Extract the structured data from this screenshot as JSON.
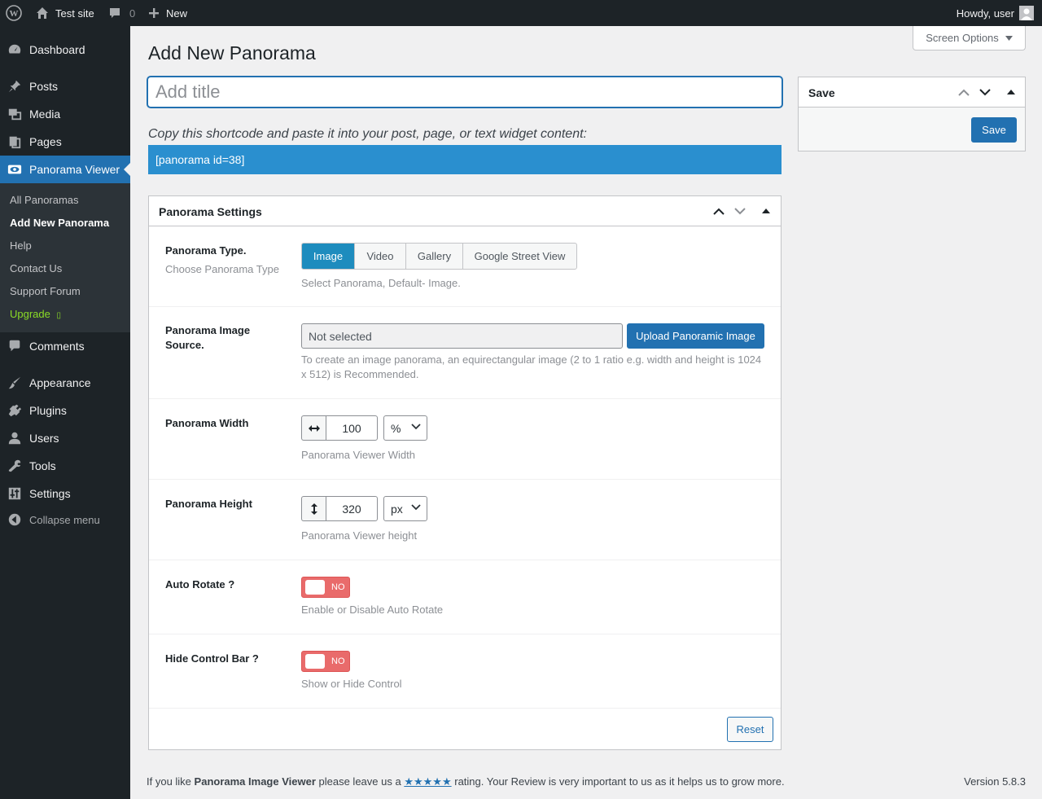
{
  "admin_bar": {
    "site_name": "Test site",
    "comments_count": "0",
    "new_label": "New",
    "howdy": "Howdy, user"
  },
  "sidebar": {
    "items": [
      {
        "label": "Dashboard",
        "icon": "dashboard-icon"
      },
      {
        "label": "Posts",
        "icon": "pin-icon"
      },
      {
        "label": "Media",
        "icon": "media-icon"
      },
      {
        "label": "Pages",
        "icon": "pages-icon"
      },
      {
        "label": "Panorama Viewer",
        "icon": "eye-icon"
      },
      {
        "label": "Comments",
        "icon": "comment-icon"
      },
      {
        "label": "Appearance",
        "icon": "brush-icon"
      },
      {
        "label": "Plugins",
        "icon": "plug-icon"
      },
      {
        "label": "Users",
        "icon": "user-icon"
      },
      {
        "label": "Tools",
        "icon": "wrench-icon"
      },
      {
        "label": "Settings",
        "icon": "sliders-icon"
      },
      {
        "label": "Collapse menu",
        "icon": "collapse-icon"
      }
    ],
    "submenu": [
      "All Panoramas",
      "Add New Panorama",
      "Help",
      "Contact Us",
      "Support Forum",
      "Upgrade"
    ],
    "upgrade_glyph": "▯"
  },
  "screen_options": "Screen Options",
  "page_title": "Add New Panorama",
  "title_placeholder": "Add title",
  "shortcode": {
    "label": "Copy this shortcode and paste it into your post, page, or text widget content:",
    "value": "[panorama id=38]"
  },
  "settings": {
    "title": "Panorama Settings",
    "type": {
      "label": "Panorama Type.",
      "sublabel": "Choose Panorama Type",
      "options": [
        "Image",
        "Video",
        "Gallery",
        "Google Street View"
      ],
      "selected": "Image",
      "desc": "Select Panorama, Default- Image."
    },
    "source": {
      "label": "Panorama Image Source.",
      "value": "Not selected",
      "button": "Upload Panoramic Image",
      "desc": "To create an image panorama, an equirectangular image (2 to 1 ratio e.g. width and height is 1024 x 512) is Recommended."
    },
    "width": {
      "label": "Panorama Width",
      "value": "100",
      "unit": "%",
      "desc": "Panorama Viewer Width"
    },
    "height": {
      "label": "Panorama Height",
      "value": "320",
      "unit": "px",
      "desc": "Panorama Viewer height"
    },
    "auto_rotate": {
      "label": "Auto Rotate ?",
      "state": "NO",
      "desc": "Enable or Disable Auto Rotate"
    },
    "hide_control": {
      "label": "Hide Control Bar ?",
      "state": "NO",
      "desc": "Show or Hide Control"
    },
    "reset": "Reset"
  },
  "save_box": {
    "title": "Save",
    "button": "Save"
  },
  "footer": {
    "prefix": "If you like",
    "plugin": "Panorama Image Viewer",
    "middle": "please leave us a",
    "stars": "★★★★★",
    "suffix": "rating. Your Review is very important to us as it helps us to grow more.",
    "version": "Version 5.8.3"
  },
  "colors": {
    "accent": "#2271b1",
    "shortcode_bg": "#2a8fcf",
    "segment_active": "#1e8cbe",
    "toggle_off": "#e96b6b",
    "upgrade": "#8bdc26"
  }
}
